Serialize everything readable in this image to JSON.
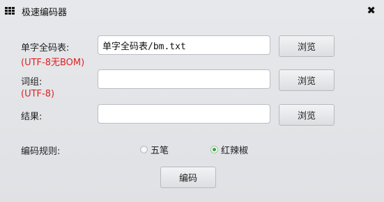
{
  "window": {
    "title": "极速编码器",
    "close_symbol": "✖"
  },
  "form": {
    "single_char": {
      "label": "单字全码表:",
      "note": "(UTF-8无BOM)",
      "value": "单字全码表/bm.txt",
      "browse_label": "浏览"
    },
    "phrase": {
      "label": "词组:",
      "note": "(UTF-8)",
      "value": "",
      "browse_label": "浏览"
    },
    "result": {
      "label": "结果:",
      "value": "",
      "browse_label": "浏览"
    },
    "rule": {
      "label": "编码规则:",
      "options": [
        {
          "label": "五笔",
          "selected": false
        },
        {
          "label": "红辣椒",
          "selected": true
        }
      ]
    },
    "encode_label": "编码"
  },
  "icons": {
    "app": "grid-menu-icon",
    "close": "close-icon"
  },
  "colors": {
    "note": "#e02020",
    "radio_selected": "#3aa53a"
  }
}
